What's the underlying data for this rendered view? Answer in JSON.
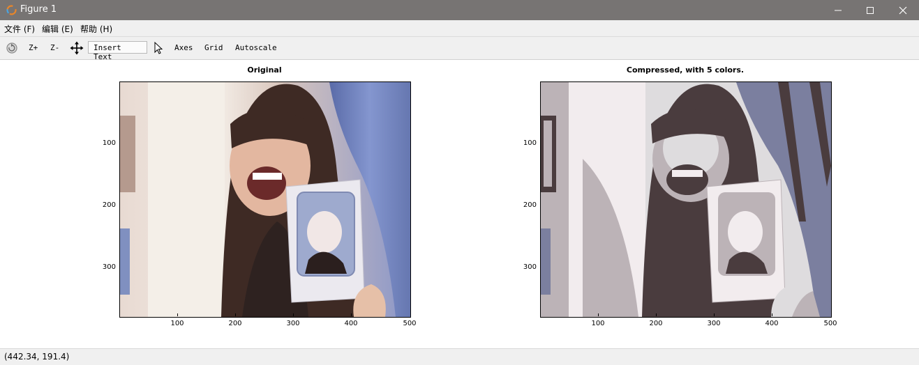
{
  "window": {
    "title": "Figure 1",
    "controls": {
      "minimize": "minimize-icon",
      "maximize": "maximize-icon",
      "close": "close-icon"
    }
  },
  "menu": [
    "文件 (F)",
    "编辑 (E)",
    "帮助 (H)"
  ],
  "toolbar": {
    "zoom_in": "Z+",
    "zoom_out": "Z-",
    "insert_text": "Insert Text",
    "axes": "Axes",
    "grid": "Grid",
    "autoscale": "Autoscale"
  },
  "plots": [
    {
      "title": "Original",
      "xticks": [
        "100",
        "200",
        "300",
        "400",
        "500"
      ],
      "yticks": [
        "100",
        "200",
        "300"
      ]
    },
    {
      "title": "Compressed, with 5 colors.",
      "xticks": [
        "100",
        "200",
        "300",
        "400",
        "500"
      ],
      "yticks": [
        "100",
        "200",
        "300"
      ]
    }
  ],
  "status": {
    "coords": "(442.34, 191.4)"
  },
  "colors": {
    "titlebar": "#777473",
    "chrome": "#f0f0f0",
    "compressed_palette": [
      "#4a3c3e",
      "#7b7f9f",
      "#bcb3b7",
      "#dedcde",
      "#f2ecee"
    ]
  }
}
